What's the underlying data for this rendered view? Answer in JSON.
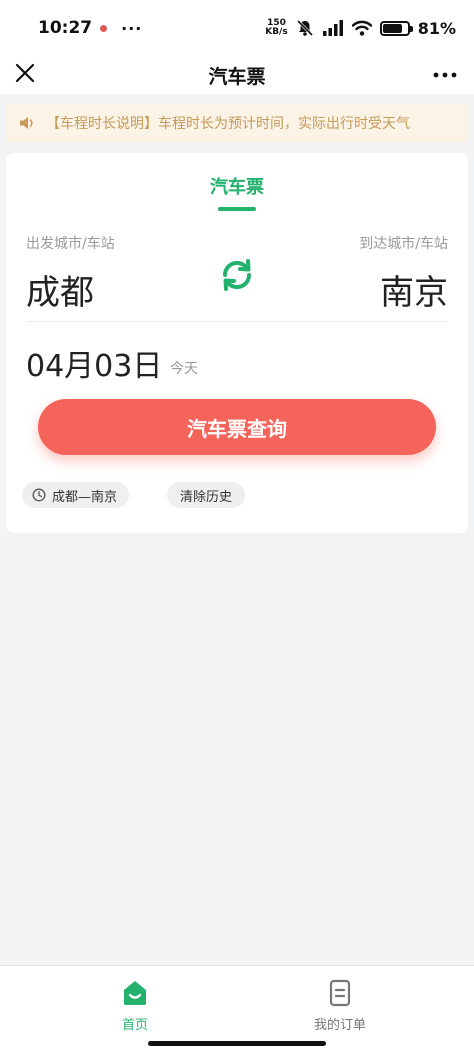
{
  "status_bar": {
    "time": "10:27",
    "more": "···",
    "net_speed_value": "150",
    "net_speed_unit": "KB/s",
    "battery_level": 0.81,
    "battery_pct": "81%"
  },
  "nav": {
    "title": "汽车票"
  },
  "notice": {
    "text": "【车程时长说明】车程时长为预计时间，实际出行时受天气"
  },
  "card": {
    "tab_label": "汽车票",
    "from_label": "出发城市/车站",
    "to_label": "到达城市/车站",
    "from_city": "成都",
    "to_city": "南京",
    "date": "04月03日",
    "date_sub": "今天",
    "search_button": "汽车票查询",
    "history_item": "成都—南京",
    "clear_history": "清除历史"
  },
  "tab_bar": {
    "home_label": "首页",
    "orders_label": "我的订单"
  },
  "colors": {
    "accent_green": "#23b26d",
    "button_red": "#f5645a",
    "notice_text": "#c69a58",
    "notice_bg": "#fbf3e6"
  },
  "icons": {
    "close": "close-icon",
    "more": "more-icon",
    "speaker": "speaker-icon",
    "swap": "swap-icon",
    "clock": "clock-icon",
    "home": "home-icon",
    "orders": "orders-icon"
  }
}
